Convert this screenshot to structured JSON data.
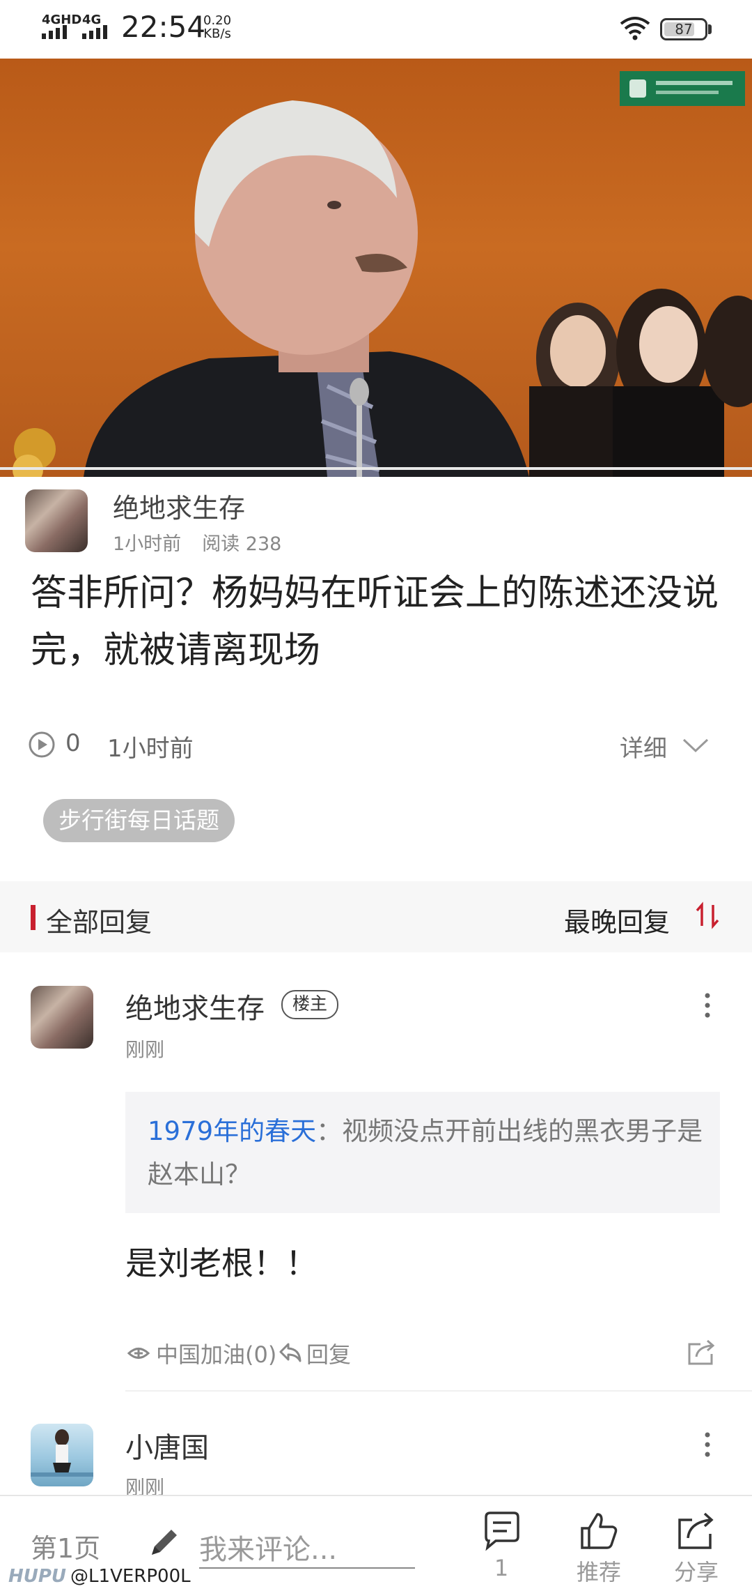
{
  "status_bar": {
    "network_1": "4GHD",
    "network_2": "4G",
    "time": "22:54",
    "speed_value": "0.20",
    "speed_unit": "KB/s",
    "battery": "87"
  },
  "video": {
    "progress": 0.0
  },
  "post": {
    "author": "绝地求生存",
    "time_ago": "1小时前",
    "read_label": "阅读 238",
    "title": "答非所问？杨妈妈在听证会上的陈述还没说完，就被请离现场",
    "play_count": "0",
    "post_time": "1小时前",
    "detail_label": "详细",
    "tag": "步行街每日话题"
  },
  "replies_header": {
    "title": "全部回复",
    "sort_label": "最晚回复"
  },
  "replies": [
    {
      "name": "绝地求生存",
      "badge": "楼主",
      "time": "刚刚",
      "quote_user": "1979年的春天",
      "quote_text": "：视频没点开前出线的黑衣男子是赵本山？",
      "body": "是刘老根！！",
      "light_label": "中国加油(0)",
      "reply_label": "回复"
    },
    {
      "name": "小唐国",
      "time": "刚刚"
    }
  ],
  "bottom_bar": {
    "page": "第1页",
    "comment_placeholder": "我来评论...",
    "comment_count": "1",
    "recommend_label": "推荐",
    "share_label": "分享",
    "watermark_brand": "HUPU",
    "watermark_user": "@L1VERP00L"
  },
  "colors": {
    "accent_red": "#c8202f",
    "link_blue": "#2a6fd8",
    "tag_gray": "#bdbdbd"
  }
}
